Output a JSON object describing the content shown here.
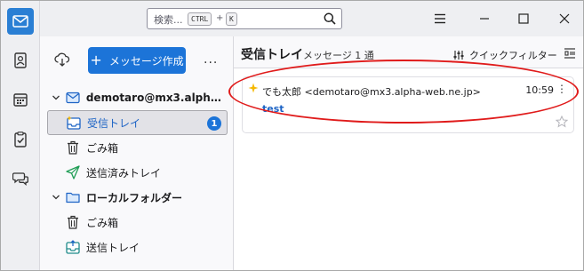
{
  "search": {
    "placeholder": "検索...",
    "key1": "CTRL",
    "plus": "+",
    "key2": "K"
  },
  "compose": {
    "label": "メッセージ作成",
    "plus": "+"
  },
  "more": "...",
  "tree": {
    "account_label": "demotaro@mx3.alpha-w...",
    "inbox_label": "受信トレイ",
    "inbox_unread": "1",
    "trash_label": "ごみ箱",
    "sent_label": "送信済みトレイ",
    "local_label": "ローカルフォルダー",
    "local_trash_label": "ごみ箱",
    "outbox_label": "送信トレイ"
  },
  "message_list": {
    "folder_title": "受信トレイ",
    "count": "メッセージ 1 通",
    "quick_filter": "クイックフィルター"
  },
  "message": {
    "sender": "でも太郎 <demotaro@mx3.alpha-web.ne.jp>",
    "time": "10:59",
    "subject": "test"
  },
  "colors": {
    "accent": "#1c74d8",
    "highlight": "#e01b1b"
  },
  "icons": [
    "mail-icon",
    "address-book-icon",
    "calendar-icon",
    "tasks-icon",
    "chat-icon",
    "search-icon",
    "menu-icon",
    "minimize-icon",
    "maximize-icon",
    "close-icon",
    "get-messages-icon",
    "folder-icon",
    "trash-icon",
    "send-icon",
    "quick-filter-icon",
    "view-options-icon",
    "star-icon"
  ]
}
